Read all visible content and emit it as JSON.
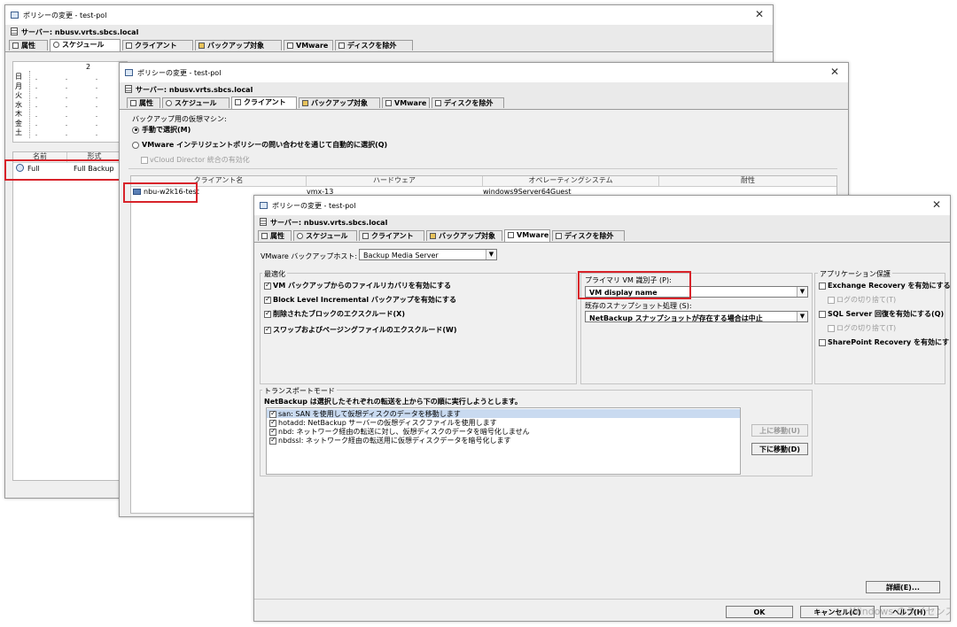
{
  "w1": {
    "title": "ポリシーの変更 - test-pol",
    "server": "サーバー: nbusv.vrts.sbcs.local",
    "tabs": [
      "属性",
      "スケジュール",
      "クライアント",
      "バックアップ対象",
      "VMware",
      "ディスクを除外"
    ],
    "active_tab": "スケジュール",
    "calendar": {
      "col_label": "2",
      "days": [
        "日",
        "月",
        "火",
        "水",
        "木",
        "金",
        "土"
      ]
    },
    "schedules": {
      "headers": [
        "名前",
        "形式"
      ],
      "rows": [
        {
          "name": "Full",
          "type": "Full Backup"
        }
      ]
    }
  },
  "w2": {
    "title": "ポリシーの変更 - test-pol",
    "server": "サーバー: nbusv.vrts.sbcs.local",
    "tabs": [
      "属性",
      "スケジュール",
      "クライアント",
      "バックアップ対象",
      "VMware",
      "ディスクを除外"
    ],
    "active_tab": "クライアント",
    "vm_label": "バックアップ用の仮想マシン:",
    "radio_manual": "手動で選択(M)",
    "radio_query": "VMware インテリジェントポリシーの問い合わせを通じて自動的に選択(Q)",
    "vcloud": "vCloud Director 統合の有効化",
    "clients": {
      "headers": [
        "クライアント名",
        "ハードウェア",
        "オペレーティングシステム",
        "耐性"
      ],
      "rows": [
        {
          "name": "nbu-w2k16-test",
          "hardware": "vmx-13",
          "os": "windows9Server64Guest",
          "res": ""
        }
      ]
    }
  },
  "w3": {
    "title": "ポリシーの変更 - test-pol",
    "server": "サーバー: nbusv.vrts.sbcs.local",
    "tabs": [
      "属性",
      "スケジュール",
      "クライアント",
      "バックアップ対象",
      "VMware",
      "ディスクを除外"
    ],
    "active_tab": "VMware",
    "backup_host_label": "VMware バックアップホスト:",
    "backup_host_value": "Backup Media Server",
    "optimization": {
      "title": "最適化",
      "options": [
        {
          "label": "VM バックアップからのファイルリカバリを有効にする",
          "checked": true
        },
        {
          "label": "Block Level Incremental バックアップを有効にする",
          "checked": true
        },
        {
          "label": "削除されたブロックのエクスクルード(X)",
          "checked": true
        },
        {
          "label": "スワップおよびページングファイルのエクスクルード(W)",
          "checked": true
        }
      ]
    },
    "primary_vm_label": "プライマリ VM 識別子 (P):",
    "primary_vm_value": "VM display name",
    "snapshot_label": "既存のスナップショット処理 (S):",
    "snapshot_value": "NetBackup スナップショットが存在する場合は中止",
    "app_protection": {
      "title": "アプリケーション保護",
      "options": [
        {
          "label": "Exchange Recovery を有効にする",
          "checked": false,
          "indent": false
        },
        {
          "label": "ログの切り捨て(T)",
          "checked": false,
          "indent": true
        },
        {
          "label": "SQL Server 回復を有効にする(Q)",
          "checked": false,
          "indent": false
        },
        {
          "label": "ログの切り捨て(T)",
          "checked": false,
          "indent": true
        },
        {
          "label": "SharePoint Recovery を有効にする",
          "checked": false,
          "indent": false
        }
      ]
    },
    "transport": {
      "title": "トランスポートモード",
      "desc": "NetBackup は選択したそれぞれの転送を上から下の順に実行しようとします。",
      "modes": [
        "san: SAN を使用して仮想ディスクのデータを移動します",
        "hotadd: NetBackup サーバーの仮想ディスクファイルを使用します",
        "nbd: ネットワーク経由の転送に対し、仮想ディスクのデータを暗号化しません",
        "nbdssl: ネットワーク経由の転送用に仮想ディスクデータを暗号化します"
      ],
      "up": "上に移動(U)",
      "down": "下に移動(D)"
    },
    "details": "詳細(E)...",
    "ok": "OK",
    "cancel": "キャンセル(C)",
    "help": "ヘルプ(H)",
    "watermark": "Windows のライセンス認"
  }
}
